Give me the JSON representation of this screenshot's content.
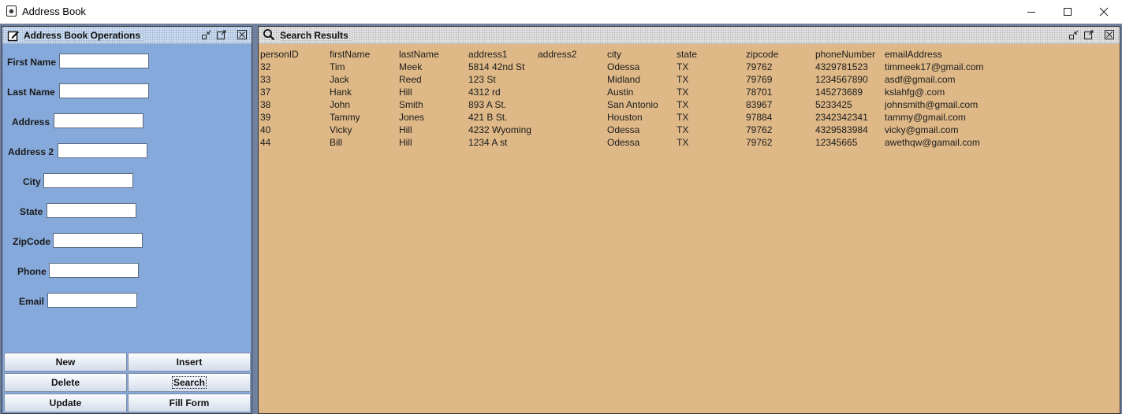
{
  "window": {
    "title": "Address Book"
  },
  "operations": {
    "title": "Address Book Operations",
    "fields": [
      {
        "label": "First Name",
        "value": ""
      },
      {
        "label": "Last Name",
        "value": ""
      },
      {
        "label": "Address",
        "value": ""
      },
      {
        "label": "Address 2",
        "value": ""
      },
      {
        "label": "City",
        "value": ""
      },
      {
        "label": "State",
        "value": ""
      },
      {
        "label": "ZipCode",
        "value": ""
      },
      {
        "label": "Phone",
        "value": ""
      },
      {
        "label": "Email",
        "value": ""
      }
    ],
    "buttons": {
      "new": "New",
      "insert": "Insert",
      "delete": "Delete",
      "search": "Search",
      "update": "Update",
      "fill_form": "Fill Form"
    }
  },
  "results": {
    "title": "Search Results",
    "columns": [
      "personID",
      "firstName",
      "lastName",
      "address1",
      "address2",
      "city",
      "state",
      "zipcode",
      "phoneNumber",
      "emailAddress"
    ],
    "rows": [
      [
        "32",
        "Tim",
        "Meek",
        "5814 42nd St",
        "",
        "Odessa",
        "TX",
        "79762",
        "4329781523",
        "timmeek17@gmail.com"
      ],
      [
        "33",
        "Jack",
        "Reed",
        "123 St",
        "",
        "Midland",
        "TX",
        "79769",
        "1234567890",
        "asdf@gmail.com"
      ],
      [
        "37",
        "Hank",
        "Hill",
        "4312 rd",
        "",
        "Austin",
        "TX",
        "78701",
        "145273689",
        "kslahfg@.com"
      ],
      [
        "38",
        "John",
        "Smith",
        "893 A St.",
        "",
        "San Antonio",
        "TX",
        "83967",
        "5233425",
        "johnsmith@gmail.com"
      ],
      [
        "39",
        "Tammy",
        "Jones",
        "421 B St.",
        "",
        "Houston",
        "TX",
        "97884",
        "2342342341",
        "tammy@gmail.com"
      ],
      [
        "40",
        "Vicky",
        "Hill",
        "4232 Wyoming",
        "",
        "Odessa",
        "TX",
        "79762",
        "4329583984",
        "vicky@gmail.com"
      ],
      [
        "44",
        "Bill",
        "Hill",
        "1234 A st",
        "",
        "Odessa",
        "TX",
        "79762",
        "12345665",
        "awethqw@gamail.com"
      ]
    ]
  },
  "icons": {
    "app": "address-book-icon",
    "operations": "edit-icon",
    "results": "search-icon"
  },
  "colors": {
    "operations_bg": "#86a9db",
    "results_bg": "#deb887"
  }
}
